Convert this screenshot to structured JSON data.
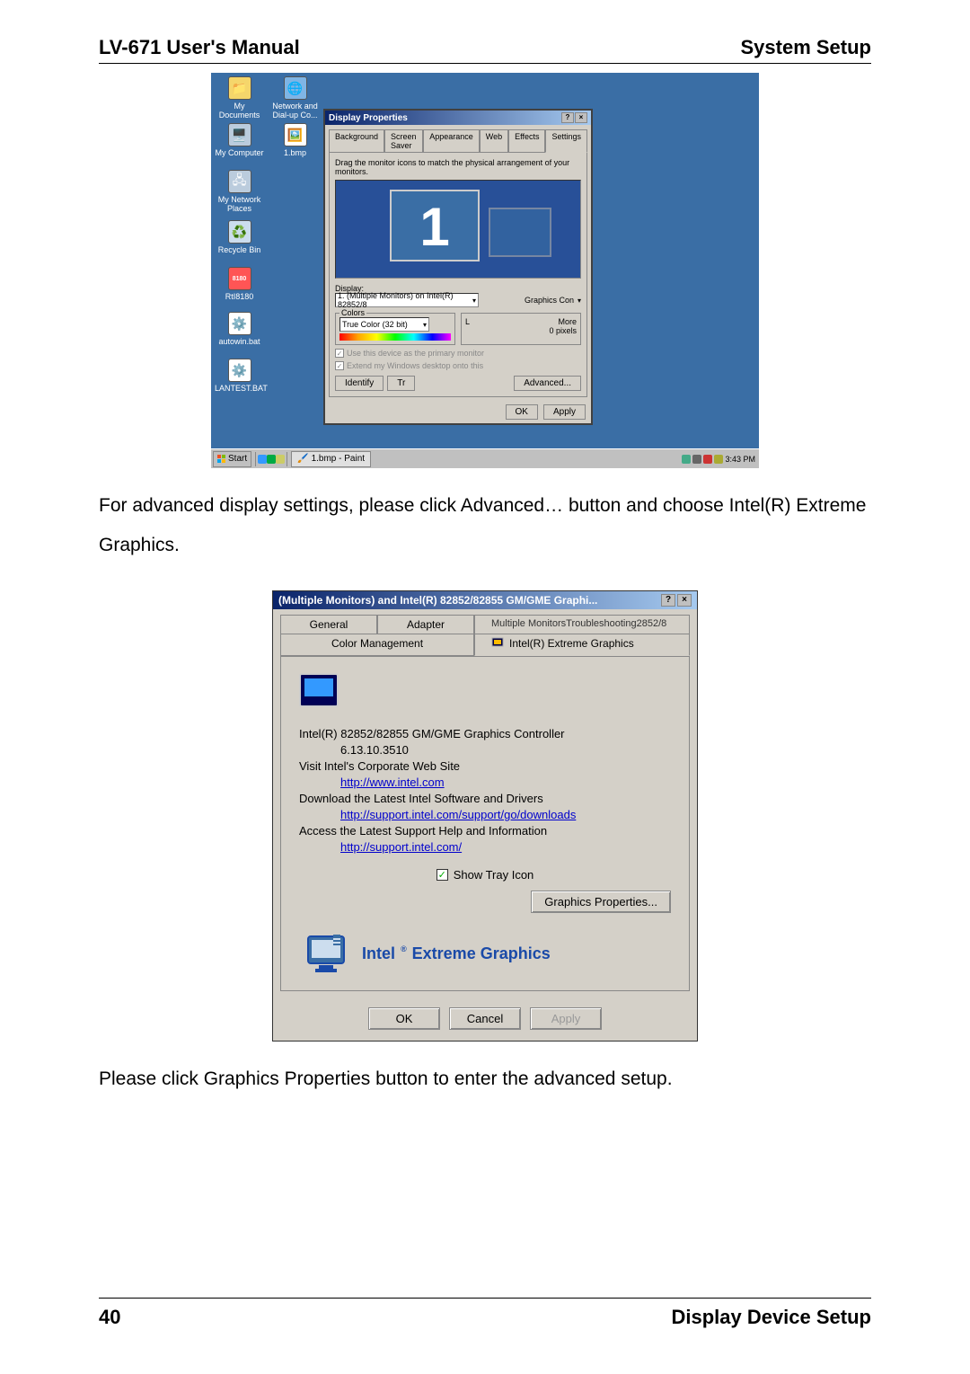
{
  "header": {
    "left": "LV-671 User's Manual",
    "right": "System Setup"
  },
  "footer": {
    "page": "40",
    "section": "Display  Device  Setup"
  },
  "desktop": {
    "icons": [
      {
        "label": "My Documents"
      },
      {
        "label": "Network and Dial-up Co..."
      },
      {
        "label": "My Computer"
      },
      {
        "label": "1.bmp"
      },
      {
        "label": "My Network Places"
      },
      {
        "label": "Recycle Bin"
      },
      {
        "label": "RtI8180"
      },
      {
        "label": "autowin.bat"
      },
      {
        "label": "LANTEST.BAT"
      }
    ],
    "taskbar": {
      "start": "Start",
      "task1": "1.bmp - Paint",
      "time": "3:43 PM"
    }
  },
  "dp": {
    "title": "Display Properties",
    "tabs": [
      "Background",
      "Screen Saver",
      "Appearance",
      "Web",
      "Effects",
      "Settings"
    ],
    "instruction": "Drag the monitor icons to match the physical arrangement of your monitors.",
    "display_label": "Display:",
    "display_value": "1. (Multiple Monitors) on Intel(R) 82852/8",
    "graphics_con": "Graphics Con",
    "colors_label": "Colors",
    "colors_value": "True Color (32 bit)",
    "more": "More",
    "pixels": "0 pixels",
    "chk1": "Use this device as the primary monitor",
    "chk2": "Extend my Windows desktop onto this",
    "identify": "Identify",
    "tr": "Tr",
    "advanced": "Advanced...",
    "ok": "OK",
    "apply": "Apply"
  },
  "body1": "For advanced display settings, please click Advanced… button and choose Intel(R) Extreme Graphics.",
  "ieg": {
    "title": "(Multiple Monitors) and Intel(R) 82852/82855 GM/GME Graphi...",
    "tabs_row1": [
      "General",
      "Adapter",
      "Multiple MonitorsTroubleshooting2852/8"
    ],
    "tabs_row2_left": "Color Management",
    "tabs_row2_right": "Intel(R) Extreme Graphics",
    "line1": "Intel(R) 82852/82855 GM/GME Graphics Controller",
    "line2": "6.13.10.3510",
    "line3": "Visit Intel's Corporate Web Site",
    "link1": "http://www.intel.com",
    "line4": "Download the Latest Intel Software and Drivers",
    "link2": "http://support.intel.com/support/go/downloads",
    "line5": "Access the Latest Support Help and Information",
    "link3": "http://support.intel.com/",
    "show_tray": "Show Tray Icon",
    "gp_btn": "Graphics Properties...",
    "brand": "Intel",
    "brand2": "Extreme Graphics",
    "ok": "OK",
    "cancel": "Cancel",
    "apply": "Apply"
  },
  "body2": "Please click Graphics Properties button to enter the advanced setup."
}
